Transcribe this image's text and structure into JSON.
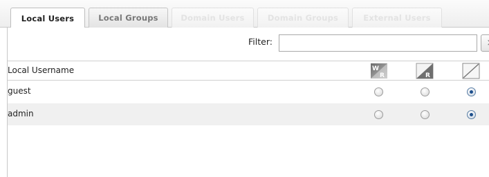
{
  "tabs": [
    {
      "label": "Local Users",
      "state": "active"
    },
    {
      "label": "Local Groups",
      "state": "normal"
    },
    {
      "label": "Domain Users",
      "state": "disabled"
    },
    {
      "label": "Domain Groups",
      "state": "disabled"
    },
    {
      "label": "External Users",
      "state": "disabled"
    }
  ],
  "filter": {
    "label": "Filter:",
    "value": "",
    "clear_icon": "×"
  },
  "table": {
    "column_username": "Local Username",
    "permission_columns": [
      {
        "icon": "write-read-icon",
        "glyph_top": "W",
        "glyph_bottom": "R"
      },
      {
        "icon": "read-only-icon",
        "glyph": "R"
      },
      {
        "icon": "no-access-icon"
      }
    ],
    "rows": [
      {
        "name": "guest",
        "selected": 2
      },
      {
        "name": "admin",
        "selected": 2
      }
    ]
  },
  "colors": {
    "radio_checked": "#1d4f8c",
    "alt_row": "#f0f0f0"
  }
}
